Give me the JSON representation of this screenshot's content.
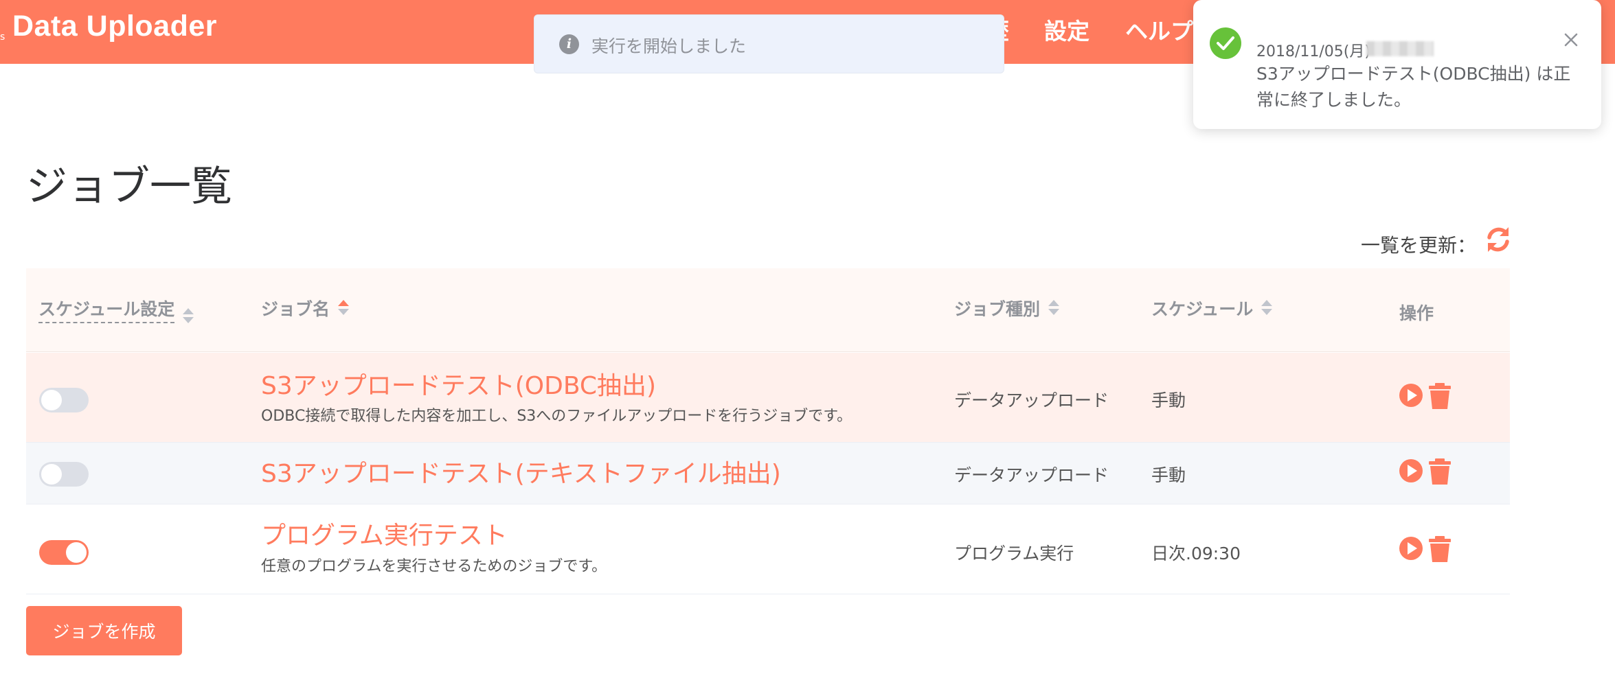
{
  "header": {
    "brand_prefix": "s",
    "brand": "Data Uploader",
    "nav": [
      {
        "label": "歴"
      },
      {
        "label": "設定"
      },
      {
        "label": "ヘルプ"
      }
    ]
  },
  "info_toast": {
    "message": "実行を開始しました"
  },
  "notification": {
    "date": "2018/11/05(月)",
    "message": "S3アップロードテスト(ODBC抽出) は正常に終了しました。"
  },
  "page": {
    "title": "ジョブ一覧",
    "refresh_label": "一覧を更新："
  },
  "table": {
    "columns": {
      "schedule_setting": "スケジュール設定",
      "job_name": "ジョブ名",
      "job_type": "ジョブ種別",
      "schedule": "スケジュール",
      "operation": "操作"
    },
    "rows": [
      {
        "enabled": false,
        "name": "S3アップロードテスト(ODBC抽出)",
        "description": "ODBC接続で取得した内容を加工し、S3へのファイルアップロードを行うジョブです。",
        "type": "データアップロード",
        "schedule": "手動"
      },
      {
        "enabled": false,
        "name": "S3アップロードテスト(テキストファイル抽出)",
        "description": "",
        "type": "データアップロード",
        "schedule": "手動"
      },
      {
        "enabled": true,
        "name": "プログラム実行テスト",
        "description": "任意のプログラムを実行させるためのジョブです。",
        "type": "プログラム実行",
        "schedule": "日次.09:30"
      }
    ]
  },
  "create_button": "ジョブを作成",
  "colors": {
    "brand": "#ff7b5e",
    "success": "#67c23a",
    "info": "#909399"
  }
}
